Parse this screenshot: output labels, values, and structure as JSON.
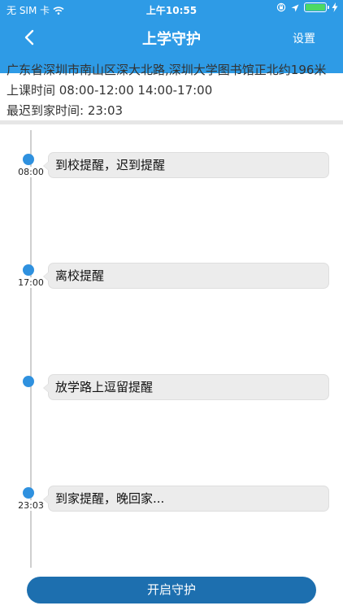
{
  "status_bar": {
    "carrier": "无 SIM 卡",
    "time": "上午10:55",
    "icons": [
      "wifi-icon",
      "orientation-lock-icon",
      "location-arrow-icon",
      "battery-icon",
      "charging-icon"
    ],
    "battery_level": 1.0,
    "battery_color": "#4cd964"
  },
  "nav": {
    "title": "上学守护",
    "settings_label": "设置",
    "back_icon": "chevron-left-icon",
    "background": "#2e9be6"
  },
  "info": {
    "address": "广东省深圳市南山区深大北路,深圳大学图书馆正北约196米",
    "class_time": "上课时间 08:00-12:00 14:00-17:00",
    "latest_home_time": "最迟到家时间: 23:03"
  },
  "timeline": [
    {
      "time": "08:00",
      "text": "到校提醒，迟到提醒"
    },
    {
      "time": "17:00",
      "text": "离校提醒"
    },
    {
      "time": "",
      "text": "放学路上逗留提醒"
    },
    {
      "time": "23:03",
      "text": "到家提醒，晚回家..."
    }
  ],
  "actions": {
    "start_guard_label": "开启守护",
    "button_color": "#1d6faf"
  }
}
